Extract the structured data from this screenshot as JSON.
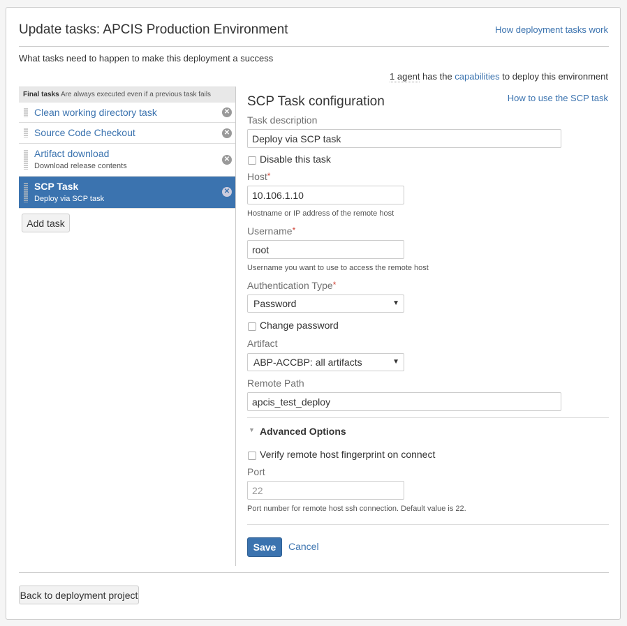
{
  "page": {
    "title": "Update tasks: APCIS Production Environment",
    "help_link": "How deployment tasks work",
    "subtitle": "What tasks need to happen to make this deployment a success",
    "agent_prefix": "1 agent",
    "agent_mid": " has the ",
    "agent_link": "capabilities",
    "agent_suffix": " to deploy this environment"
  },
  "sidebar": {
    "header_title": "Final tasks",
    "header_desc": "Are always executed even if a previous task fails",
    "tasks": [
      {
        "title": "Clean working directory task",
        "subtitle": ""
      },
      {
        "title": "Source Code Checkout",
        "subtitle": ""
      },
      {
        "title": "Artifact download",
        "subtitle": "Download release contents"
      },
      {
        "title": "SCP Task",
        "subtitle": "Deploy via SCP task"
      }
    ],
    "add_task": "Add task"
  },
  "config": {
    "heading": "SCP Task configuration",
    "help_link": "How to use the SCP task",
    "task_description_label": "Task description",
    "task_description_value": "Deploy via SCP task",
    "disable_label": "Disable this task",
    "host_label": "Host",
    "host_value": "10.106.1.10",
    "host_desc": "Hostname or IP address of the remote host",
    "username_label": "Username",
    "username_value": "root",
    "username_desc": "Username you want to use to access the remote host",
    "auth_label": "Authentication Type",
    "auth_value": "Password",
    "change_password_label": "Change password",
    "artifact_label": "Artifact",
    "artifact_value": "ABP-ACCBP: all artifacts",
    "remote_path_label": "Remote Path",
    "remote_path_value": "apcis_test_deploy",
    "advanced_label": "Advanced Options",
    "verify_label": "Verify remote host fingerprint on connect",
    "port_label": "Port",
    "port_placeholder": "22",
    "port_desc": "Port number for remote host ssh connection. Default value is 22.",
    "required_mark": "*",
    "save": "Save",
    "cancel": "Cancel"
  },
  "footer": {
    "back_button": "Back to deployment project"
  },
  "colors": {
    "link": "#3b73af",
    "active_task_bg": "#3b73af",
    "required": "#d04437"
  }
}
